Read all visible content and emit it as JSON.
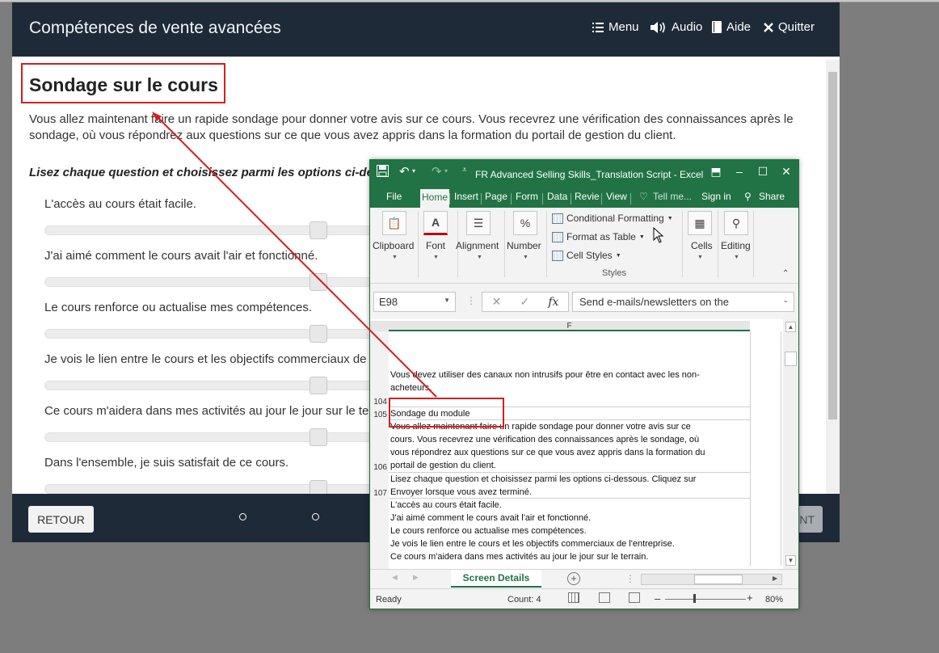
{
  "course": {
    "title": "Compétences de vente avancées",
    "header_buttons": {
      "menu": "Menu",
      "audio": "Audio",
      "help": "Aide",
      "quit": "Quitter"
    },
    "page_heading": "Sondage sur le cours",
    "intro": "Vous allez maintenant faire un rapide sondage pour donner votre avis sur ce cours. Vous recevrez une vérification des connaissances après le sondage, où vous répondrez aux questions sur ce que vous avez appris dans la formation du portail de gestion du client.",
    "instruction": "Lisez chaque question et choisissez parmi les options ci-dessous.",
    "questions": [
      "L'accès au cours était facile.",
      "J'ai aimé comment le cours avait l'air et fonctionné.",
      "Le cours renforce ou actualise mes compétences.",
      "Je vois le lien entre le cours et les objectifs commerciaux de l'entreprise.",
      "Ce cours m'aidera dans mes activités au jour le jour sur le terrain.",
      "Dans l'ensemble, je suis satisfait de ce cours."
    ],
    "slider_levels": [
      0.81,
      0.81,
      0.81,
      0.81,
      0.81,
      0.81
    ],
    "footer": {
      "back": "RETOUR",
      "next": "NT"
    }
  },
  "excel": {
    "window_title": "FR Advanced Selling Skills_Translation Script  -  Excel",
    "tabs": [
      "File",
      "Home",
      "Insert",
      "Page",
      "Form",
      "Data",
      "Revie",
      "View"
    ],
    "active_tab": "Home",
    "tell_me": "Tell me...",
    "sign_in": "Sign in",
    "share": "Share",
    "ribbon": {
      "clipboard": "Clipboard",
      "font": "Font",
      "alignment": "Alignment",
      "number": "Number",
      "conditional_formatting": "Conditional Formatting",
      "format_as_table": "Format as Table",
      "cell_styles": "Cell Styles",
      "styles": "Styles",
      "cells": "Cells",
      "editing": "Editing"
    },
    "name_box": "E98",
    "formula": "Send e-mails/newsletters on the",
    "column_header": "F",
    "rows": [
      {
        "num": "104",
        "lines": [
          "Vous devez utiliser des canaux non intrusifs pour être en contact avec les non-",
          "acheteurs."
        ]
      },
      {
        "num": "105",
        "lines": [
          "Sondage du module"
        ]
      },
      {
        "num": "106",
        "lines": [
          "Vous allez maintenant faire un rapide sondage pour donner votre avis sur ce",
          "cours. Vous recevrez une vérification des connaissances après le sondage, où",
          "vous répondrez aux questions sur ce que vous avez appris dans la formation du",
          "portail de gestion du client."
        ]
      },
      {
        "num": "107",
        "lines": [
          "Lisez chaque question et choisissez parmi les options ci-dessous. Cliquez sur",
          "Envoyer lorsque vous avez terminé."
        ]
      },
      {
        "num": "",
        "lines": [
          "L'accès au cours était facile.",
          "J'ai aimé comment le cours avait l'air et fonctionné.",
          "Le cours renforce ou actualise mes compétences.",
          "Je vois le lien entre le cours et les objectifs commerciaux de l'entreprise.",
          "Ce cours m'aidera dans mes activités au jour le jour sur le terrain."
        ]
      }
    ],
    "sheet_tab": "Screen Details",
    "status": {
      "ready": "Ready",
      "count": "Count: 4",
      "zoom": "80%"
    }
  },
  "colors": {
    "excel_green": "#217346",
    "course_header": "#1e2a38",
    "annotation_red": "#d31f1f"
  }
}
